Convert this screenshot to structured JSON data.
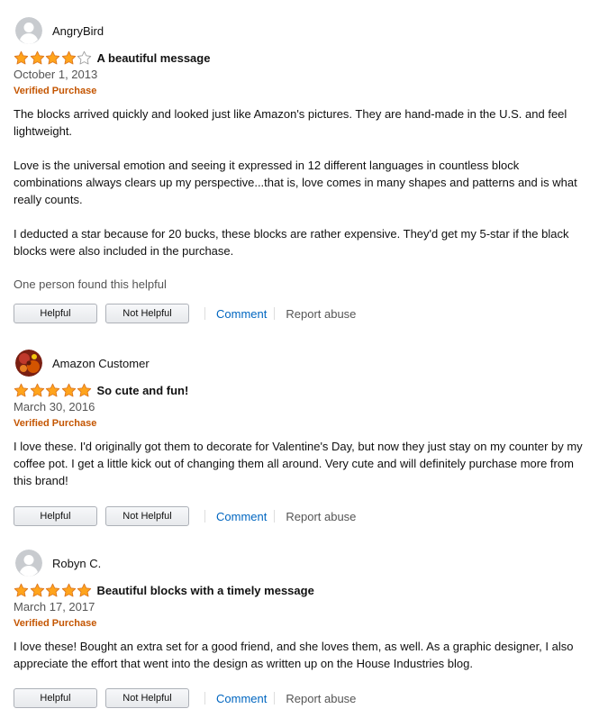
{
  "colors": {
    "star": "#ffa41c",
    "star_outline": "#de7921",
    "verified": "#c45500",
    "link": "#0066c0"
  },
  "buttons": {
    "helpful": "Helpful",
    "not_helpful": "Not Helpful",
    "comment": "Comment",
    "report": "Report abuse"
  },
  "reviews": [
    {
      "author": "AngryBird",
      "avatar_icon": "default-avatar-icon",
      "rating": 4,
      "title": "A beautiful message",
      "date": "October 1, 2013",
      "verified": "Verified Purchase",
      "paragraphs": [
        "The blocks arrived quickly and looked just like Amazon's pictures. They are hand-made in the U.S. and feel lightweight.",
        "Love is the universal emotion and seeing it expressed in 12 different languages in countless block combinations always clears up my perspective...that is, love comes in many shapes and patterns and is what really counts.",
        "I deducted a star because for 20 bucks, these blocks are rather expensive. They'd get my 5-star if the black blocks were also included in the purchase."
      ],
      "helpful_count": "One person found this helpful"
    },
    {
      "author": "Amazon Customer",
      "avatar_icon": "photo-avatar-icon",
      "rating": 5,
      "title": "So cute and fun!",
      "date": "March 30, 2016",
      "verified": "Verified Purchase",
      "paragraphs": [
        "I love these. I'd originally got them to decorate for Valentine's Day, but now they just stay on my counter by my coffee pot. I get a little kick out of changing them all around. Very cute and will definitely purchase more from this brand!"
      ]
    },
    {
      "author": "Robyn C.",
      "avatar_icon": "default-avatar-icon",
      "rating": 5,
      "title": "Beautiful blocks with a timely message",
      "date": "March 17, 2017",
      "verified": "Verified Purchase",
      "paragraphs": [
        "I love these! Bought an extra set for a good friend, and she loves them, as well. As a graphic designer, I also appreciate the effort that went into the design as written up on the House Industries blog."
      ]
    }
  ]
}
